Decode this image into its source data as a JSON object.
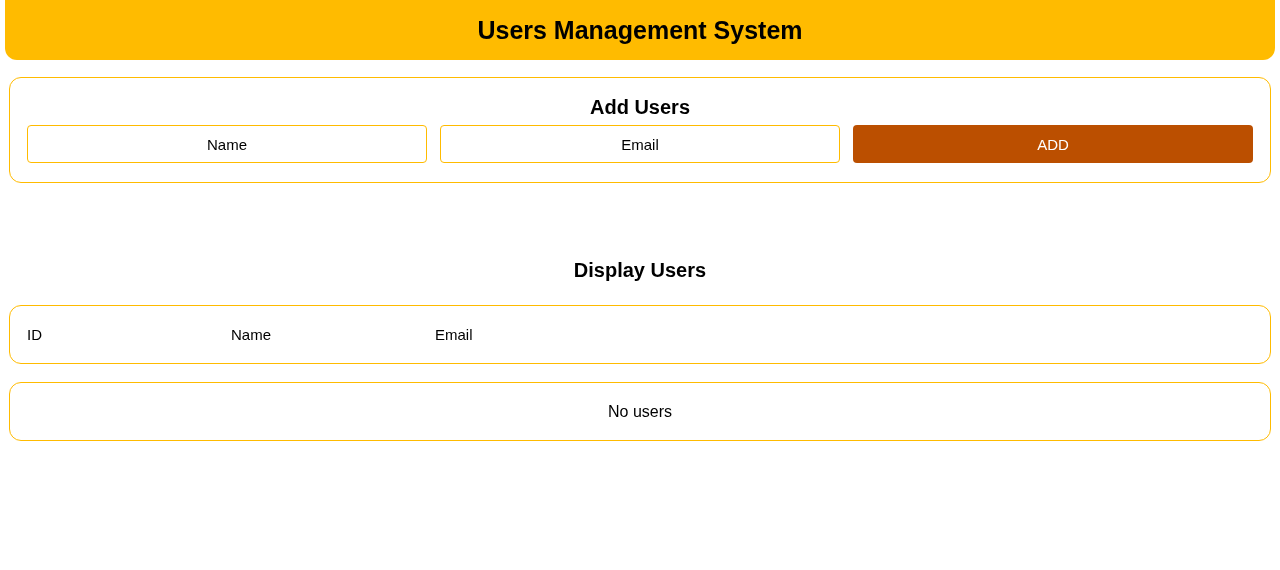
{
  "header": {
    "title": "Users Management System"
  },
  "add_form": {
    "title": "Add Users",
    "name_field": {
      "placeholder": "Name"
    },
    "email_field": {
      "placeholder": "Email"
    },
    "button": "ADD"
  },
  "display": {
    "title": "Display Users",
    "columns": [
      "ID",
      "Name",
      "Email"
    ],
    "empty_message": "No users"
  }
}
